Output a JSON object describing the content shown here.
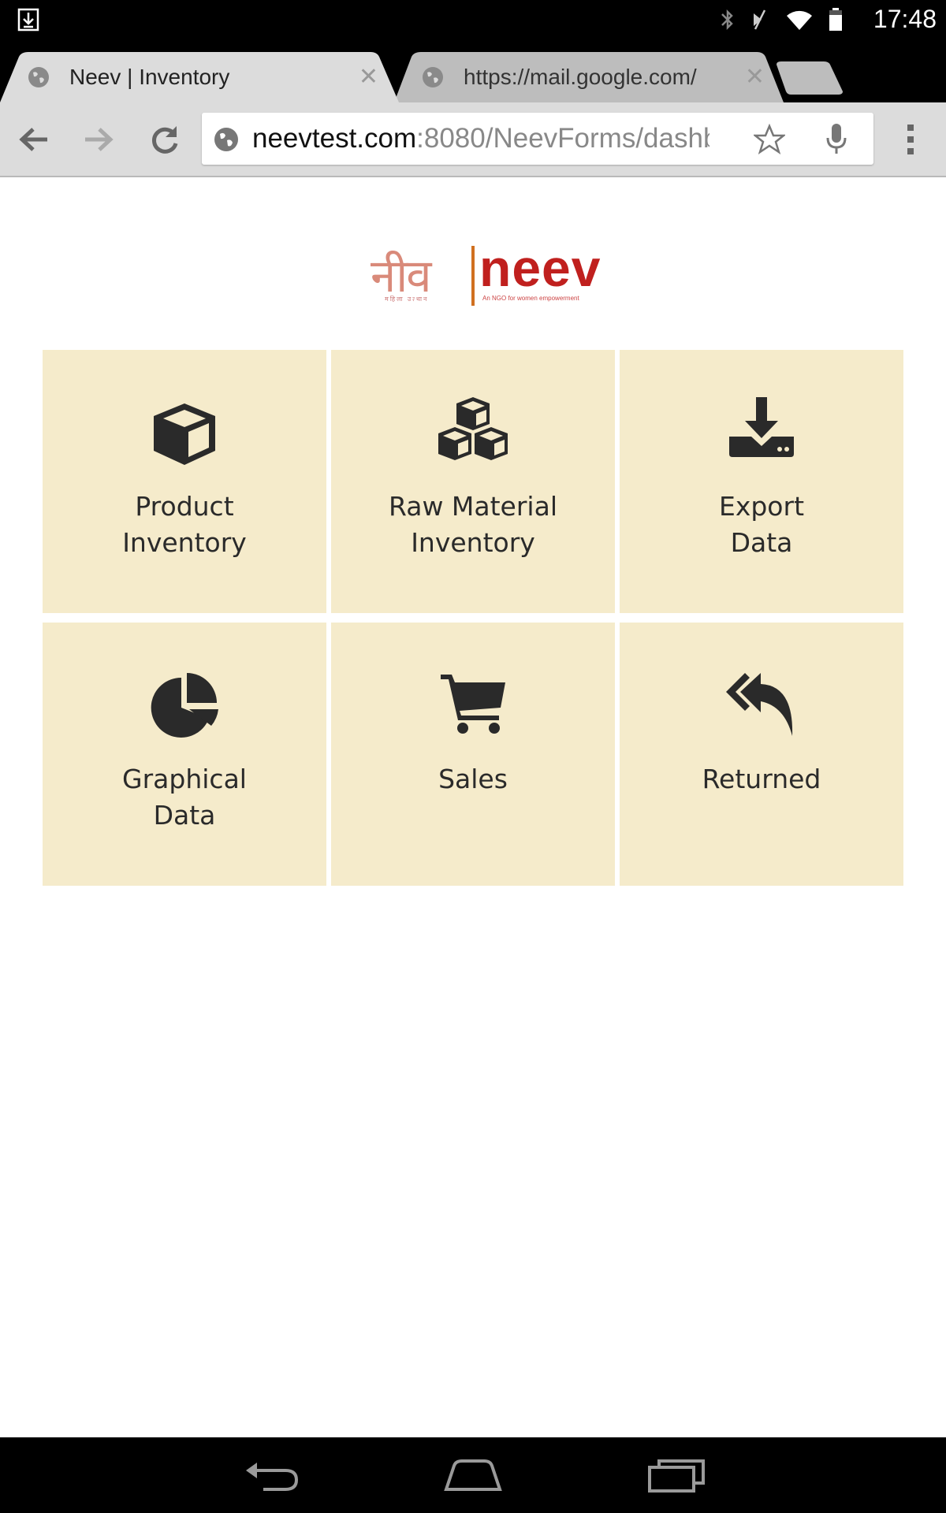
{
  "status_bar": {
    "time": "17:48"
  },
  "browser": {
    "tabs": [
      {
        "title": "Neev | Inventory",
        "active": true
      },
      {
        "title": "https://mail.google.com/",
        "active": false
      }
    ],
    "url": {
      "host": "neevtest.com",
      "path": ":8080/NeevForms/dashb"
    }
  },
  "logo": {
    "hindi": "नीव",
    "english": "neev",
    "tagline_hindi": "महिला उत्थान",
    "tagline_english": "An NGO for women empowerment"
  },
  "dashboard": {
    "tiles": [
      {
        "id": "product-inventory",
        "icon": "cube-icon",
        "label_lines": [
          "Product",
          "Inventory"
        ]
      },
      {
        "id": "raw-material-inventory",
        "icon": "cubes-icon",
        "label_lines": [
          "Raw Material",
          "Inventory"
        ]
      },
      {
        "id": "export-data",
        "icon": "download-icon",
        "label_lines": [
          "Export",
          "Data"
        ]
      },
      {
        "id": "graphical-data",
        "icon": "pie-chart-icon",
        "label_lines": [
          "Graphical",
          "Data"
        ]
      },
      {
        "id": "sales",
        "icon": "shopping-cart-icon",
        "label_lines": [
          "Sales"
        ]
      },
      {
        "id": "returned",
        "icon": "reply-all-icon",
        "label_lines": [
          "Returned"
        ]
      }
    ]
  },
  "colors": {
    "tile_background": "#f5ebcb",
    "logo_red": "#c0201e",
    "toolbar": "#dcdcdc"
  }
}
